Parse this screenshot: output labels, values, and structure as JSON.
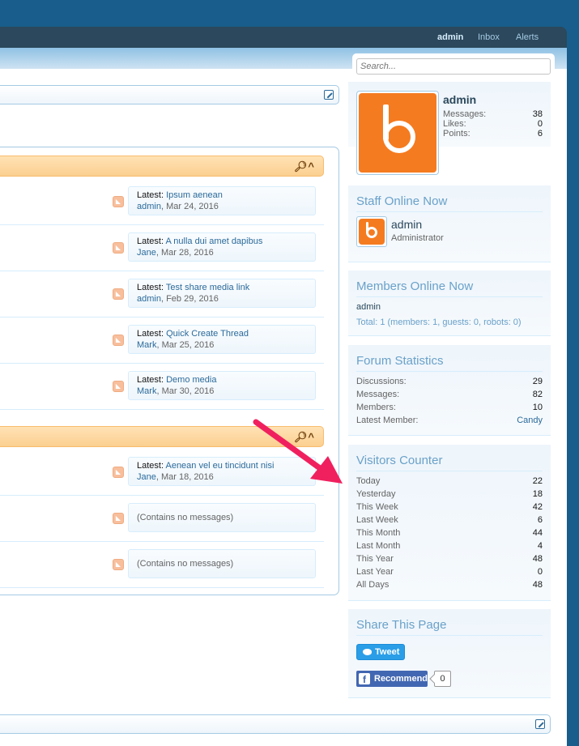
{
  "nav": {
    "user": "admin",
    "inbox": "Inbox",
    "alerts": "Alerts"
  },
  "search": {
    "placeholder": "Search..."
  },
  "categories": [
    {
      "nodes": [
        {
          "latest_label": "Latest:",
          "title": "Ipsum aenean",
          "user": "admin",
          "date": ", Mar 24, 2016"
        },
        {
          "latest_label": "Latest:",
          "title": "A nulla dui amet dapibus",
          "user": "Jane",
          "date": ", Mar 28, 2016"
        },
        {
          "latest_label": "Latest:",
          "title": "Test share media link",
          "user": "admin",
          "date": ", Feb 29, 2016"
        },
        {
          "latest_label": "Latest:",
          "title": "Quick Create Thread",
          "user": "Mark",
          "date": ", Mar 25, 2016"
        },
        {
          "latest_label": "Latest:",
          "title": "Demo media",
          "user": "Mark",
          "date": ", Mar 30, 2016"
        }
      ]
    },
    {
      "nodes": [
        {
          "latest_label": "Latest:",
          "title": "Aenean vel eu tincidunt nisi",
          "user": "Jane",
          "date": ", Mar 18, 2016"
        },
        {
          "empty_text": "(Contains no messages)"
        },
        {
          "empty_text": "(Contains no messages)"
        }
      ]
    }
  ],
  "visitor_panel": {
    "username": "admin",
    "stats": [
      {
        "label": "Messages:",
        "value": "38"
      },
      {
        "label": "Likes:",
        "value": "0"
      },
      {
        "label": "Points:",
        "value": "6"
      }
    ]
  },
  "staff_online": {
    "heading": "Staff Online Now",
    "member": {
      "name": "admin",
      "title": "Administrator"
    }
  },
  "members_online": {
    "heading": "Members Online Now",
    "member": "admin",
    "total": "Total: 1 (members: 1, guests: 0, robots: 0)"
  },
  "forum_stats": {
    "heading": "Forum Statistics",
    "rows": [
      {
        "label": "Discussions:",
        "value": "29"
      },
      {
        "label": "Messages:",
        "value": "82"
      },
      {
        "label": "Members:",
        "value": "10"
      },
      {
        "label": "Latest Member:",
        "value": "Candy"
      }
    ]
  },
  "visitors_counter": {
    "heading": "Visitors Counter",
    "rows": [
      {
        "label": "Today",
        "value": "22"
      },
      {
        "label": "Yesterday",
        "value": "18"
      },
      {
        "label": "This Week",
        "value": "42"
      },
      {
        "label": "Last Week",
        "value": "6"
      },
      {
        "label": "This Month",
        "value": "44"
      },
      {
        "label": "Last Month",
        "value": "4"
      },
      {
        "label": "This Year",
        "value": "48"
      },
      {
        "label": "Last Year",
        "value": "0"
      },
      {
        "label": "All Days",
        "value": "48"
      }
    ]
  },
  "share": {
    "heading": "Share This Page",
    "tweet": "Tweet",
    "recommend": "Recommend",
    "recommend_count": "0"
  },
  "colors": {
    "header_bg": "#185d8b",
    "nav_bg": "#2b485c",
    "accent_link": "#2b6a9a",
    "category_orange": "#fbcf90",
    "annotation_arrow": "#f0205f"
  }
}
